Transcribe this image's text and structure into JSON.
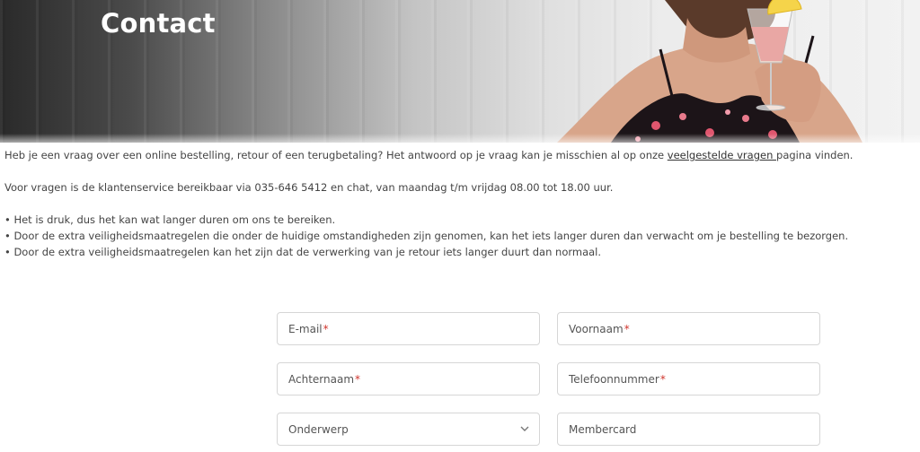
{
  "hero": {
    "title": "Contact"
  },
  "intro": {
    "line1_before": "Heb je een vraag over een online bestelling, retour of een terugbetaling? Het antwoord op je vraag kan je misschien al op onze ",
    "line1_link": "veelgestelde vragen ",
    "line1_after": " pagina vinden.",
    "line2": "Voor vragen is de klantenservice bereikbaar via 035-646 5412 en chat, van maandag t/m vrijdag 08.00 tot 18.00 uur.",
    "bullets": [
      "• Het is druk, dus het kan wat langer duren om ons te bereiken.",
      "• Door de extra veiligheidsmaatregelen die onder de huidige omstandigheden zijn genomen, kan het iets langer duren dan verwacht om je bestelling te bezorgen.",
      "• Door de extra veiligheidsmaatregelen kan het zijn dat de verwerking van je retour iets langer duurt dan normaal."
    ]
  },
  "form": {
    "email": {
      "label": "E-mail",
      "required": "*"
    },
    "first_name": {
      "label": "Voornaam",
      "required": "*"
    },
    "last_name": {
      "label": "Achternaam",
      "required": "*"
    },
    "phone": {
      "label": "Telefoonnummer",
      "required": "*"
    },
    "subject": {
      "label": "Onderwerp"
    },
    "membercard": {
      "label": "Membercard"
    }
  },
  "colors": {
    "required": "#d0342c",
    "border": "#d6d6d6",
    "text": "#444444"
  },
  "icons": {
    "select": "chevron-down-icon"
  }
}
